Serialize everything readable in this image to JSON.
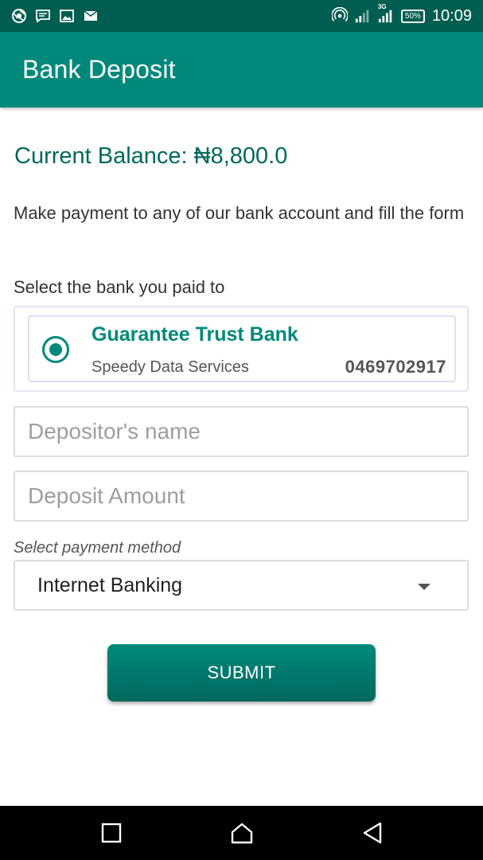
{
  "status_bar": {
    "time": "10:09",
    "battery": "50%",
    "network": "3G",
    "icons": [
      "chrome-icon",
      "message-icon",
      "image-icon",
      "mail-icon",
      "hotspot-icon",
      "signal-icon",
      "signal-3g-icon",
      "battery-icon"
    ]
  },
  "app_bar": {
    "title": "Bank Deposit"
  },
  "balance": {
    "text": "Current Balance: ₦8,800.0"
  },
  "instruction": "Make payment to any of our bank account and fill the form",
  "select_bank_label": "Select the bank you paid to",
  "bank": {
    "name": "Guarantee Trust Bank",
    "account_name": "Speedy Data Services",
    "account_number": "0469702917",
    "selected": true
  },
  "form": {
    "depositor_placeholder": "Depositor's name",
    "amount_placeholder": "Deposit Amount",
    "method_label": "Select payment method",
    "method_value": "Internet Banking",
    "submit_label": "SUBMIT"
  },
  "colors": {
    "primary": "#00897b",
    "primary_dark": "#005e50",
    "balance_text": "#00695c"
  }
}
